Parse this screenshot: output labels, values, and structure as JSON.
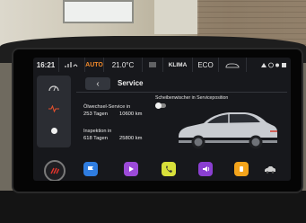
{
  "topbar": {
    "clock": "16:21",
    "mode": "AUTO",
    "temperature": "21.0°C",
    "klima": "KLIMA",
    "eco": "ECO"
  },
  "page": {
    "title": "Service",
    "back": "‹"
  },
  "toggle": {
    "label": "Scheibenwischer in Serviceposition",
    "state": "off"
  },
  "service": {
    "oil_label": "Ölwechsel-Service in",
    "oil_days": "253 Tagen",
    "oil_km": "10600 km",
    "inspection_label": "Inspektion in",
    "inspection_days": "618 Tagen",
    "inspection_km": "25800 km"
  },
  "colors": {
    "accent": "#f28a2b",
    "dock_red": "#d8342b",
    "dock_blue": "#2f7de0",
    "dock_purple": "#9c4ad8",
    "dock_yellow": "#d8e03a",
    "dock_violet": "#8a3fd1",
    "dock_orange": "#f4a41b"
  },
  "icons": [
    "speedometer-icon",
    "heartbeat-icon",
    "dot-icon",
    "home-icon",
    "flag-icon",
    "play-icon",
    "phone-icon",
    "sound-icon",
    "connect-icon",
    "car-icon"
  ]
}
